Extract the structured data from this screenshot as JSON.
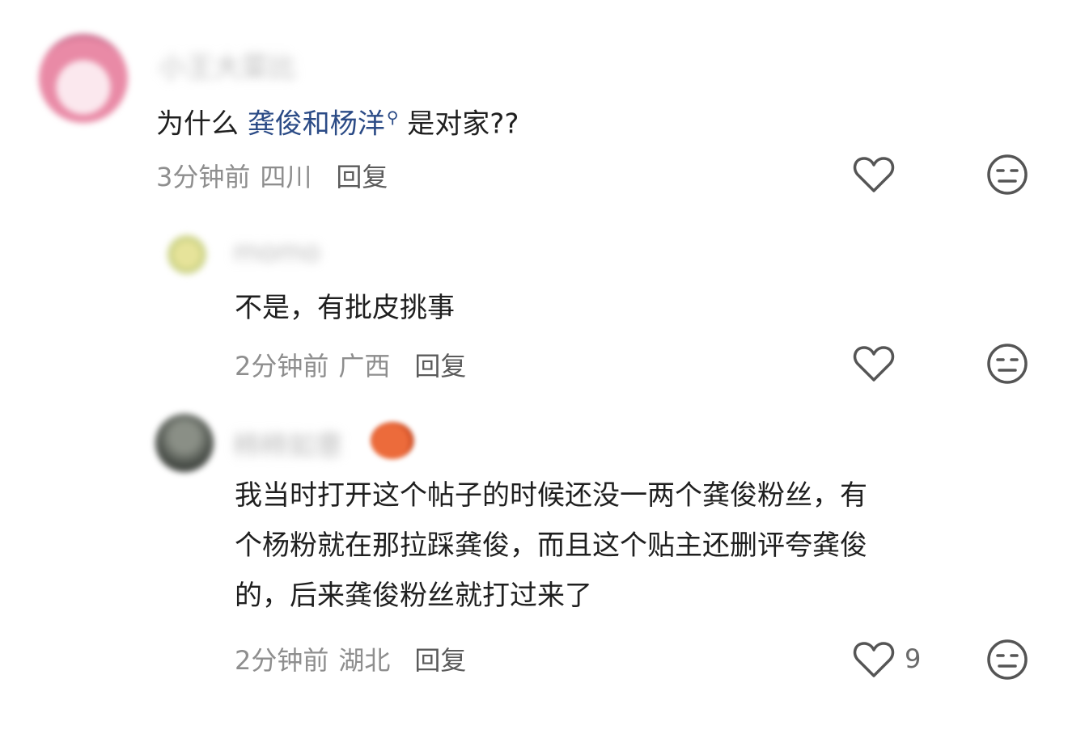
{
  "comments": [
    {
      "username": "小王大菜比",
      "text_before": "为什么 ",
      "link_text": "龚俊和杨洋",
      "text_after": " 是对家??",
      "time": "3分钟前",
      "location": "四川",
      "reply_label": "回复",
      "like_icon": "heart-icon",
      "dislike_icon": "meh-face-icon"
    },
    {
      "username": "momo",
      "text": "不是，有批皮挑事",
      "time": "2分钟前",
      "location": "广西",
      "reply_label": "回复",
      "like_icon": "heart-icon",
      "dislike_icon": "meh-face-icon"
    },
    {
      "username": "柿柿如意",
      "text_lines": [
        "我当时打开这个帖子的时候还没一两个龚俊粉丝，有",
        "个杨粉就在那拉踩龚俊，而且这个贴主还删评夸龚俊",
        "的，后来龚俊粉丝就打过来了"
      ],
      "time": "2分钟前",
      "location": "湖北",
      "reply_label": "回复",
      "like_count": "9",
      "like_icon": "heart-icon",
      "dislike_icon": "meh-face-icon"
    }
  ],
  "colors": {
    "link": "#2b4b86",
    "meta": "#8e8e8e",
    "icon": "#555555"
  }
}
